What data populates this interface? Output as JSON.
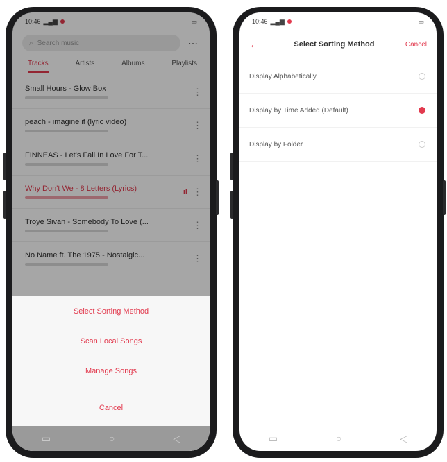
{
  "left": {
    "status": {
      "time": "10:46",
      "battery": ""
    },
    "search_placeholder": "Search music",
    "tabs": [
      "Tracks",
      "Artists",
      "Albums",
      "Playlists"
    ],
    "tracks": [
      {
        "title": "Small Hours - Glow Box",
        "playing": false
      },
      {
        "title": "peach - imagine if (lyric video)",
        "playing": false
      },
      {
        "title": "FINNEAS - Let's Fall In Love For T...",
        "playing": false
      },
      {
        "title": "Why Don't We - 8 Letters (Lyrics)",
        "playing": true
      },
      {
        "title": "Troye Sivan - Somebody To Love (...",
        "playing": false
      },
      {
        "title": "No Name ft. The 1975 - Nostalgic...",
        "playing": false
      }
    ],
    "sheet": {
      "options": [
        "Select Sorting Method",
        "Scan Local Songs",
        "Manage Songs"
      ],
      "cancel": "Cancel"
    }
  },
  "right": {
    "status": {
      "time": "10:46",
      "battery": ""
    },
    "title": "Select Sorting Method",
    "cancel": "Cancel",
    "options": [
      {
        "label": "Display Alphabetically",
        "selected": false
      },
      {
        "label": "Display by Time Added (Default)",
        "selected": true
      },
      {
        "label": "Display by Folder",
        "selected": false
      }
    ]
  },
  "colors": {
    "accent": "#e23a4e"
  }
}
